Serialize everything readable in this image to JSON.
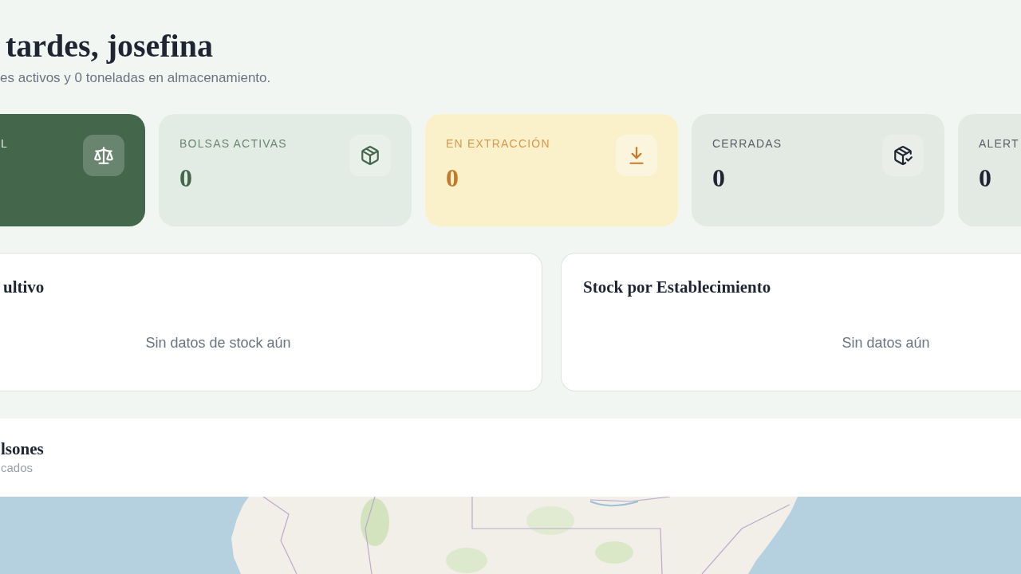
{
  "greeting": {
    "title": "tardes, josefina",
    "summary": "es activos y 0 toneladas en almacenamiento."
  },
  "stats": [
    {
      "kind": "total",
      "label": "L"
    },
    {
      "kind": "active",
      "label": "BOLSAS ACTIVAS",
      "value": "0"
    },
    {
      "kind": "extracting",
      "label": "EN EXTRACCIÓN",
      "value": "0"
    },
    {
      "kind": "closed",
      "label": "CERRADAS",
      "value": "0"
    },
    {
      "kind": "alert",
      "label": "ALERT",
      "value": "0"
    }
  ],
  "panels": [
    {
      "title": "ultivo",
      "empty_message": "Sin datos de stock aún"
    },
    {
      "title": "Stock por Establecimiento",
      "empty_message": "Sin datos aún"
    }
  ],
  "map_section": {
    "title": "lsones",
    "subtitle": "cados"
  }
}
